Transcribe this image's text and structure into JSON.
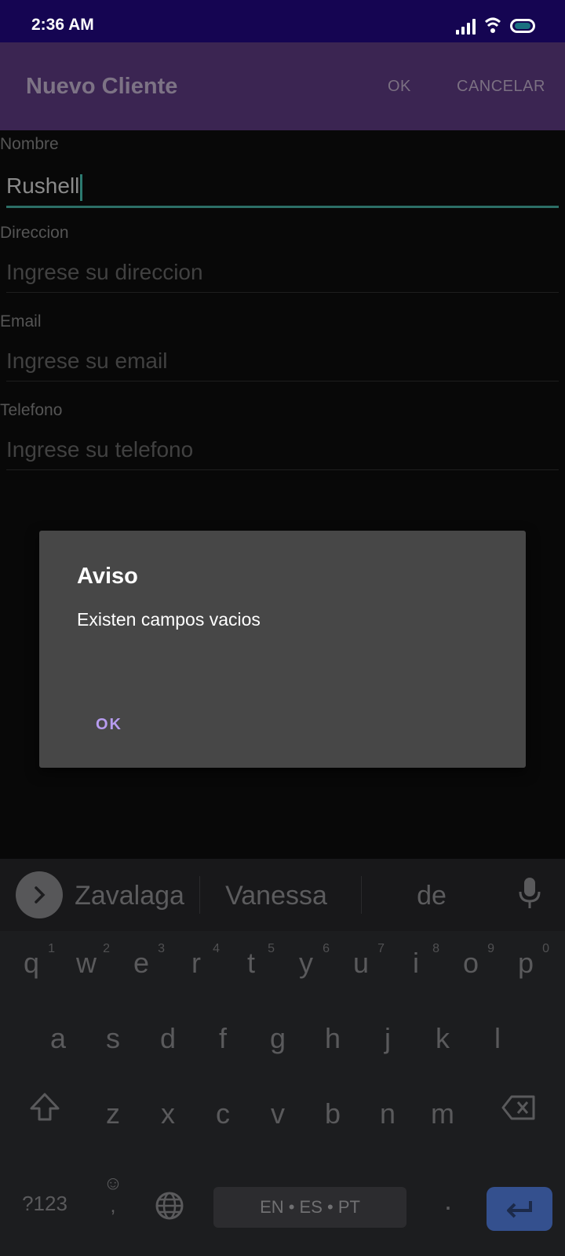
{
  "status": {
    "time": "2:36 AM"
  },
  "appbar": {
    "title": "Nuevo Cliente",
    "ok_label": "OK",
    "cancel_label": "CANCELAR"
  },
  "form": {
    "nombre_label": "Nombre",
    "nombre_value": "Rushell",
    "direccion_label": "Direccion",
    "direccion_placeholder": "Ingrese su direccion",
    "email_label": "Email",
    "email_placeholder": "Ingrese su email",
    "telefono_label": "Telefono",
    "telefono_placeholder": "Ingrese su telefono"
  },
  "dialog": {
    "title": "Aviso",
    "message": "Existen campos vacios",
    "ok_label": "OK"
  },
  "keyboard": {
    "suggestions": [
      "Zavalaga",
      "Vanessa",
      "de"
    ],
    "row1": [
      {
        "k": "q",
        "n": "1"
      },
      {
        "k": "w",
        "n": "2"
      },
      {
        "k": "e",
        "n": "3"
      },
      {
        "k": "r",
        "n": "4"
      },
      {
        "k": "t",
        "n": "5"
      },
      {
        "k": "y",
        "n": "6"
      },
      {
        "k": "u",
        "n": "7"
      },
      {
        "k": "i",
        "n": "8"
      },
      {
        "k": "o",
        "n": "9"
      },
      {
        "k": "p",
        "n": "0"
      }
    ],
    "row2": [
      "a",
      "s",
      "d",
      "f",
      "g",
      "h",
      "j",
      "k",
      "l"
    ],
    "row3": [
      "z",
      "x",
      "c",
      "v",
      "b",
      "n",
      "m"
    ],
    "symbols_label": "?123",
    "emoji_label": "☺",
    "comma_label": ",",
    "space_label": "EN • ES • PT",
    "period_label": "."
  },
  "colors": {
    "accent": "#2c6e66",
    "dialog_button": "#b79cf0",
    "appbar": "#3b2552",
    "statusbar": "#150552"
  }
}
